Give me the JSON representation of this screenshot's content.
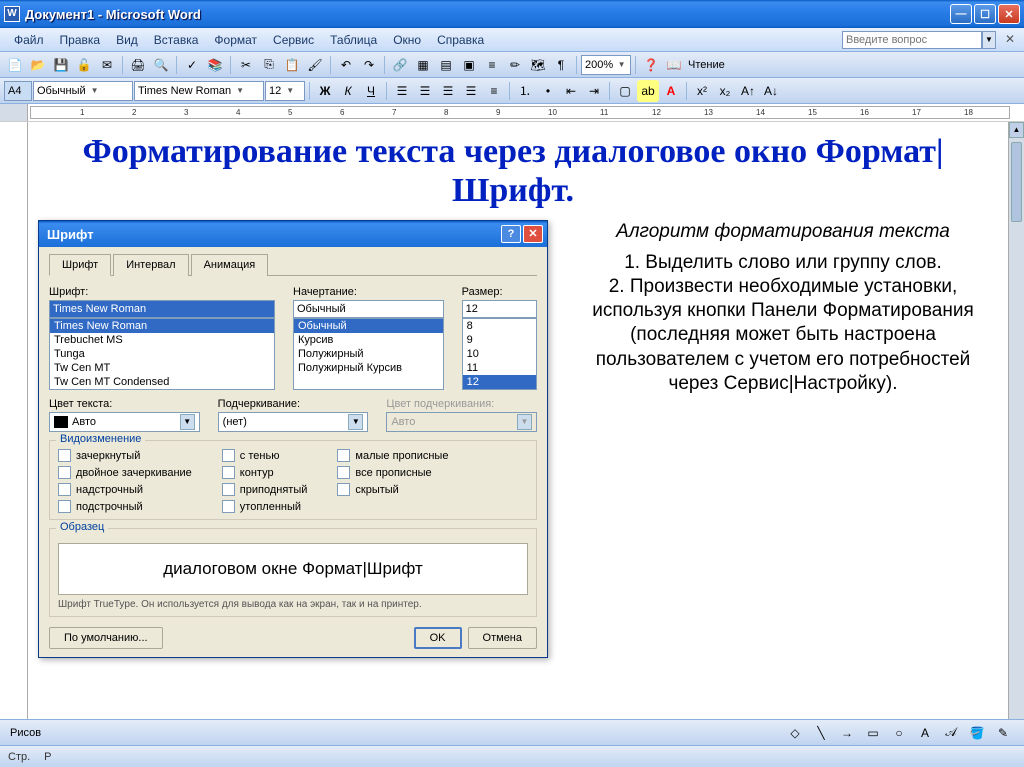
{
  "titlebar": {
    "title": "Документ1 - Microsoft Word",
    "appicon": "W"
  },
  "menu": {
    "items": [
      "Файл",
      "Правка",
      "Вид",
      "Вставка",
      "Формат",
      "Сервис",
      "Таблица",
      "Окно",
      "Справка"
    ],
    "question_placeholder": "Введите вопрос"
  },
  "toolbar1": {
    "zoom": "200%",
    "reading": "Чтение"
  },
  "toolbar2": {
    "styleA": "A4",
    "style": "Обычный",
    "font": "Times New Roman",
    "size": "12"
  },
  "document": {
    "title": "Форматирование текста через диалоговое окно Формат|Шрифт.",
    "algo_title": "Алгоритм форматирования текста",
    "step1": "1. Выделить слово или группу слов.",
    "step2": "2. Произвести необходимые установки, используя кнопки Панели Форматирования (последняя может быть настроена пользователем с учетом его потребностей через Сервис|Настройку)."
  },
  "dialog": {
    "title": "Шрифт",
    "tabs": [
      "Шрифт",
      "Интервал",
      "Анимация"
    ],
    "labels": {
      "font": "Шрифт:",
      "style": "Начертание:",
      "size": "Размер:",
      "color": "Цвет текста:",
      "underline": "Подчеркивание:",
      "underline_color": "Цвет подчеркивания:",
      "effects": "Видоизменение",
      "sample": "Образец"
    },
    "font_value": "Times New Roman",
    "font_list": [
      "Times New Roman",
      "Trebuchet MS",
      "Tunga",
      "Tw Cen MT",
      "Tw Cen MT Condensed"
    ],
    "style_value": "Обычный",
    "style_list": [
      "Обычный",
      "Курсив",
      "Полужирный",
      "Полужирный Курсив"
    ],
    "size_value": "12",
    "size_list": [
      "8",
      "9",
      "10",
      "11",
      "12"
    ],
    "color_value": "Авто",
    "underline_value": "(нет)",
    "underline_color_value": "Авто",
    "effects": {
      "col1": [
        "зачеркнутый",
        "двойное зачеркивание",
        "надстрочный",
        "подстрочный"
      ],
      "col2": [
        "с тенью",
        "контур",
        "приподнятый",
        "утопленный"
      ],
      "col3": [
        "малые прописные",
        "все прописные",
        "скрытый"
      ]
    },
    "preview_text": "диалоговом окне Формат|Шрифт",
    "footer_note": "Шрифт TrueType. Он используется для вывода как на экран, так и на принтер.",
    "buttons": {
      "default": "По умолчанию...",
      "ok": "OK",
      "cancel": "Отмена"
    }
  },
  "bottom": {
    "draw_label": "Рисов"
  },
  "status": {
    "page": "Стр.",
    "section": "Р"
  }
}
